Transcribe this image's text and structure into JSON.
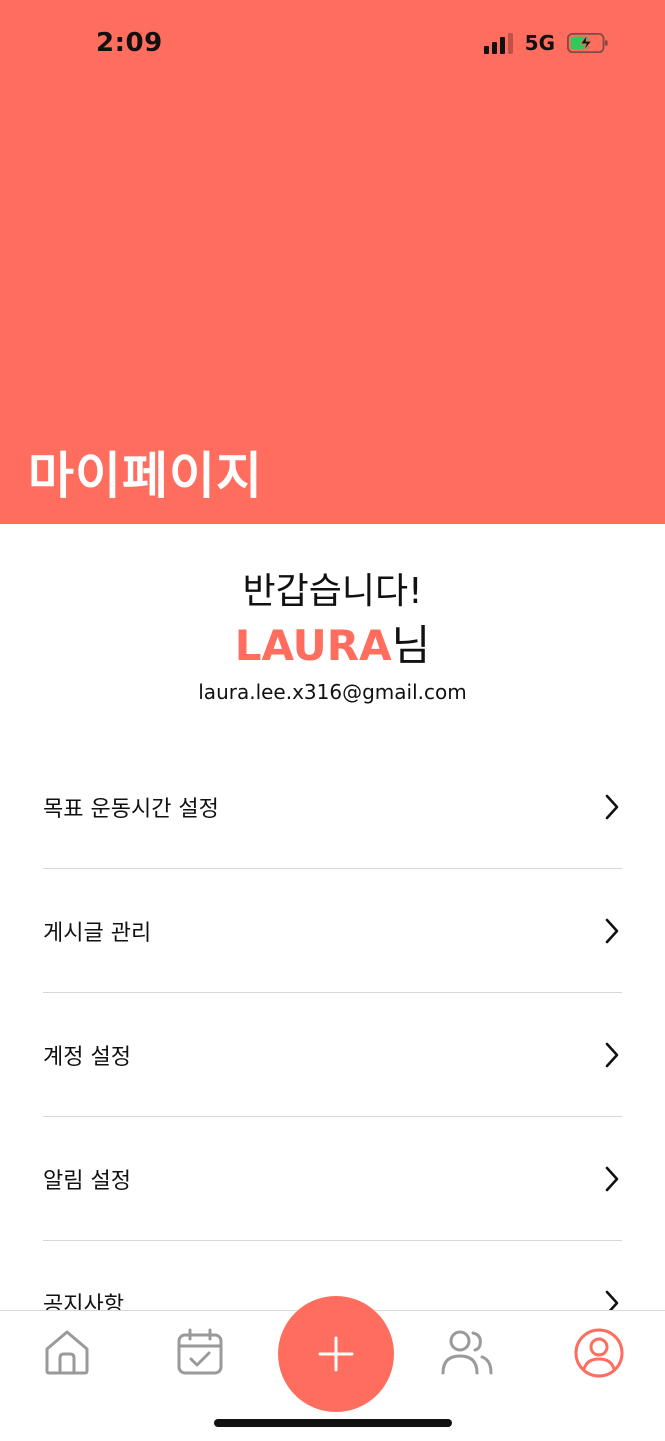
{
  "status_bar": {
    "time": "2:09",
    "network": "5G",
    "battery_charging": true,
    "battery_level": 0.55
  },
  "header": {
    "title": "마이페이지"
  },
  "profile": {
    "greeting": "반갑습니다!",
    "user_name": "LAURA",
    "name_suffix": "님",
    "email": "laura.lee.x316@gmail.com"
  },
  "menu": {
    "items": [
      {
        "label": "목표 운동시간 설정",
        "icon": "chevron-right-icon"
      },
      {
        "label": "게시글 관리",
        "icon": "chevron-right-icon"
      },
      {
        "label": "계정 설정",
        "icon": "chevron-right-icon"
      },
      {
        "label": "알림 설정",
        "icon": "chevron-right-icon"
      },
      {
        "label": "공지사항",
        "icon": "chevron-right-icon"
      }
    ]
  },
  "tabbar": {
    "tabs": [
      {
        "name": "home",
        "icon": "home-icon",
        "active": false
      },
      {
        "name": "calendar",
        "icon": "calendar-check-icon",
        "active": false
      },
      {
        "name": "add",
        "icon": "plus-icon",
        "active": false
      },
      {
        "name": "community",
        "icon": "users-icon",
        "active": false
      },
      {
        "name": "profile",
        "icon": "user-circle-icon",
        "active": true
      }
    ]
  },
  "colors": {
    "accent": "#FF6D5F",
    "text": "#111111",
    "inactive_icon": "#9a9a9a",
    "divider": "#d7d7d7"
  }
}
